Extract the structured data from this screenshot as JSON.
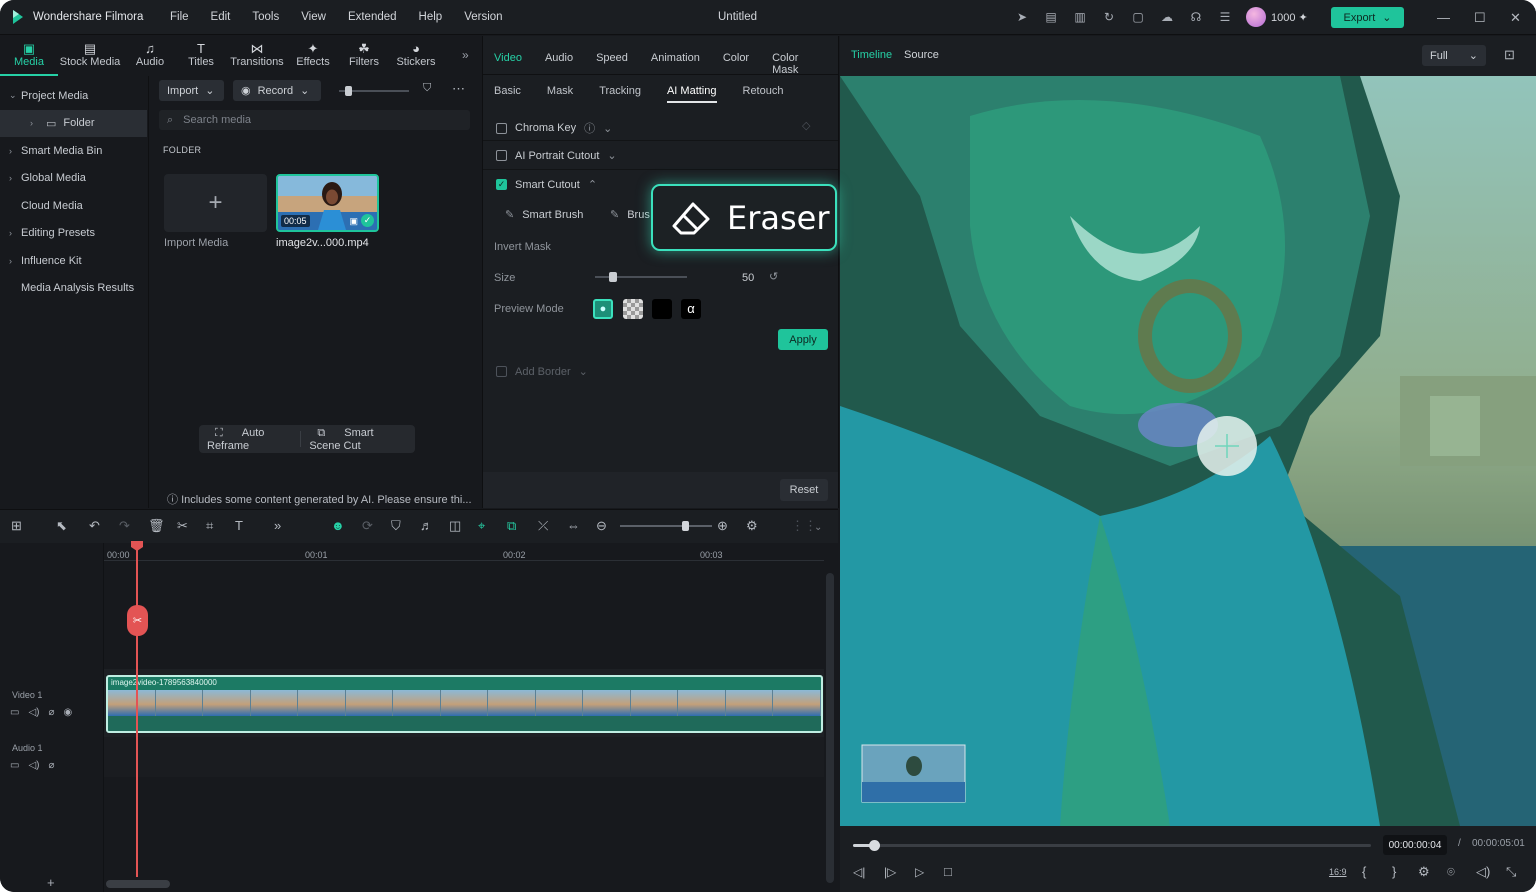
{
  "app": {
    "name": "Wondershare Filmora",
    "title": "Untitled",
    "credits": "1000",
    "export_label": "Export",
    "menu": [
      "File",
      "Edit",
      "Tools",
      "View",
      "Extended",
      "Help",
      "Version"
    ]
  },
  "nav": {
    "items": [
      {
        "label": "Media",
        "icon": "media-icon",
        "glyph": "▣"
      },
      {
        "label": "Stock Media",
        "icon": "stock-media-icon",
        "glyph": "▤"
      },
      {
        "label": "Audio",
        "icon": "audio-icon",
        "glyph": "♫"
      },
      {
        "label": "Titles",
        "icon": "titles-icon",
        "glyph": "T"
      },
      {
        "label": "Transitions",
        "icon": "transitions-icon",
        "glyph": "⋈"
      },
      {
        "label": "Effects",
        "icon": "effects-icon",
        "glyph": "✦"
      },
      {
        "label": "Filters",
        "icon": "filters-icon",
        "glyph": "☘"
      },
      {
        "label": "Stickers",
        "icon": "stickers-icon",
        "glyph": "◕"
      }
    ]
  },
  "sidebar": {
    "items": [
      {
        "label": "Project Media",
        "chev": "⌄"
      },
      {
        "label": "Folder",
        "chev": "›"
      },
      {
        "label": "Smart Media Bin",
        "chev": "›"
      },
      {
        "label": "Global Media",
        "chev": "›"
      },
      {
        "label": "Cloud Media",
        "chev": ""
      },
      {
        "label": "Editing Presets",
        "chev": "›"
      },
      {
        "label": "Influence Kit",
        "chev": "›"
      },
      {
        "label": "Media Analysis Results",
        "chev": ""
      }
    ]
  },
  "media": {
    "import_label": "Import",
    "record_label": "Record",
    "search_placeholder": "Search media",
    "folder_heading": "FOLDER",
    "import_tile_label": "Import Media",
    "clip_label": "image2v...000.mp4",
    "clip_duration": "00:05",
    "auto_reframe": "Auto Reframe",
    "smart_scene_cut": "Smart Scene Cut",
    "ai_note": "Includes some content generated by AI. Please ensure thi..."
  },
  "props": {
    "tabs": [
      "Video",
      "Audio",
      "Speed",
      "Animation",
      "Color",
      "Color Mask"
    ],
    "subtabs": [
      "Basic",
      "Mask",
      "Tracking",
      "AI Matting",
      "Retouch"
    ],
    "chroma_key": "Chroma Key",
    "ai_portrait_cutout": "AI Portrait Cutout",
    "smart_cutout": "Smart Cutout",
    "smart_brush": "Smart Brush",
    "brush_partial": "Brus",
    "invert_mask": "Invert Mask",
    "size_label": "Size",
    "size_value": "50",
    "size_fraction": 0.2,
    "preview_mode": "Preview Mode",
    "apply_label": "Apply",
    "add_border": "Add Border",
    "reset_label": "Reset",
    "eraser_label": "Eraser"
  },
  "player": {
    "tab_timeline": "Timeline",
    "tab_source": "Source",
    "quality": "Full",
    "current_time": "00:00:00:04",
    "separator": "/",
    "total_time": "00:00:05:01",
    "aspect": "16:9",
    "progress_fraction": 0.04
  },
  "timeline": {
    "ruler": [
      "00:00",
      "00:01",
      "00:02",
      "00:03"
    ],
    "video_track": "Video 1",
    "audio_track": "Audio 1",
    "clip_name": "image2video-1789563840000",
    "add_track": "+"
  },
  "colors": {
    "accent": "#1fc49b",
    "playhead": "#e35454",
    "highlight_glow": "#3be1bd"
  }
}
